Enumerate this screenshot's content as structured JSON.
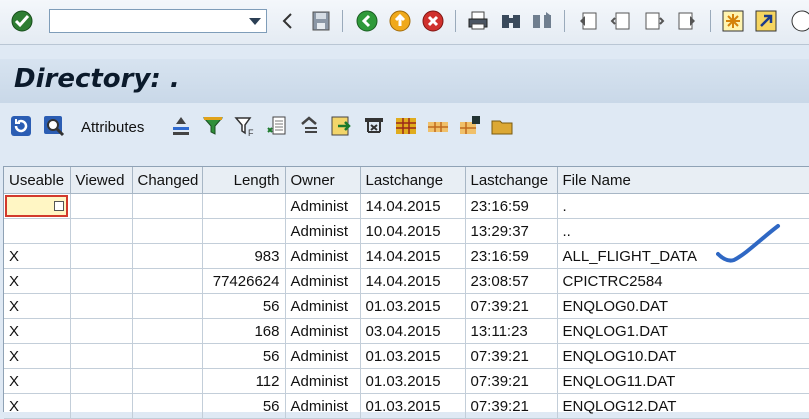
{
  "toolbar": {
    "command_field": {
      "value": "",
      "placeholder": ""
    },
    "icons": [
      "enter-check-icon",
      "command-dropdown-icon",
      "back-arrow-icon",
      "save-icon",
      "back-icon",
      "exit-icon",
      "cancel-icon",
      "print-icon",
      "find-icon",
      "find-next-icon",
      "first-page-icon",
      "previous-page-icon",
      "next-page-icon",
      "last-page-icon",
      "new-session-icon",
      "create-shortcut-icon"
    ]
  },
  "title": "Directory: .",
  "app_toolbar": {
    "attributes_label": "Attributes",
    "icons": [
      "refresh-icon",
      "details-icon",
      "sort-ascending-icon",
      "filter-icon",
      "filter-options-icon",
      "export-icon",
      "subtotal-icon",
      "transfer-icon",
      "column-selection-icon",
      "layout-icon",
      "layout-choose-icon",
      "layout-save-icon",
      "folder-icon"
    ]
  },
  "table": {
    "columns": [
      "Useable",
      "Viewed",
      "Changed",
      "Length",
      "Owner",
      "Lastchange",
      "Lastchange",
      "File Name"
    ],
    "rows": [
      {
        "useable": "",
        "viewed": "",
        "changed": "",
        "length": "",
        "owner": "Administ",
        "date": "14.04.2015",
        "time": "23:16:59",
        "file": "."
      },
      {
        "useable": "",
        "viewed": "",
        "changed": "",
        "length": "",
        "owner": "Administ",
        "date": "10.04.2015",
        "time": "13:29:37",
        "file": ".."
      },
      {
        "useable": "X",
        "viewed": "",
        "changed": "",
        "length": "983",
        "owner": "Administ",
        "date": "14.04.2015",
        "time": "23:16:59",
        "file": "ALL_FLIGHT_DATA"
      },
      {
        "useable": "X",
        "viewed": "",
        "changed": "",
        "length": "77426624",
        "owner": "Administ",
        "date": "14.04.2015",
        "time": "23:08:57",
        "file": "CPICTRC2584"
      },
      {
        "useable": "X",
        "viewed": "",
        "changed": "",
        "length": "56",
        "owner": "Administ",
        "date": "01.03.2015",
        "time": "07:39:21",
        "file": "ENQLOG0.DAT"
      },
      {
        "useable": "X",
        "viewed": "",
        "changed": "",
        "length": "168",
        "owner": "Administ",
        "date": "03.04.2015",
        "time": "13:11:23",
        "file": "ENQLOG1.DAT"
      },
      {
        "useable": "X",
        "viewed": "",
        "changed": "",
        "length": "56",
        "owner": "Administ",
        "date": "01.03.2015",
        "time": "07:39:21",
        "file": "ENQLOG10.DAT"
      },
      {
        "useable": "X",
        "viewed": "",
        "changed": "",
        "length": "112",
        "owner": "Administ",
        "date": "01.03.2015",
        "time": "07:39:21",
        "file": "ENQLOG11.DAT"
      },
      {
        "useable": "X",
        "viewed": "",
        "changed": "",
        "length": "56",
        "owner": "Administ",
        "date": "01.03.2015",
        "time": "07:39:21",
        "file": "ENQLOG12.DAT"
      }
    ]
  },
  "annotation": {
    "color": "#2f68c4",
    "icon": "checkmark-annotation-icon"
  }
}
